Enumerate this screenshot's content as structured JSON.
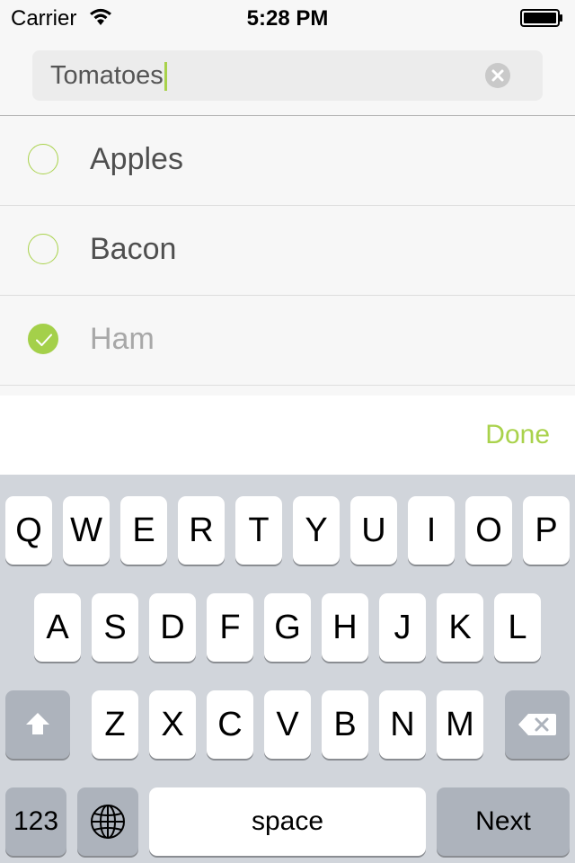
{
  "status_bar": {
    "carrier": "Carrier",
    "time": "5:28 PM"
  },
  "search": {
    "value": "Tomatoes"
  },
  "list": {
    "items": [
      {
        "label": "Apples",
        "checked": false
      },
      {
        "label": "Bacon",
        "checked": false
      },
      {
        "label": "Ham",
        "checked": true
      }
    ]
  },
  "toolbar": {
    "done_label": "Done"
  },
  "keyboard": {
    "row1": [
      "Q",
      "W",
      "E",
      "R",
      "T",
      "Y",
      "U",
      "I",
      "O",
      "P"
    ],
    "row2": [
      "A",
      "S",
      "D",
      "F",
      "G",
      "H",
      "J",
      "K",
      "L"
    ],
    "row3": [
      "Z",
      "X",
      "C",
      "V",
      "B",
      "N",
      "M"
    ],
    "numbers_label": "123",
    "space_label": "space",
    "next_label": "Next"
  },
  "colors": {
    "accent": "#a9d24b",
    "keyboard_bg": "#d1d5db"
  }
}
